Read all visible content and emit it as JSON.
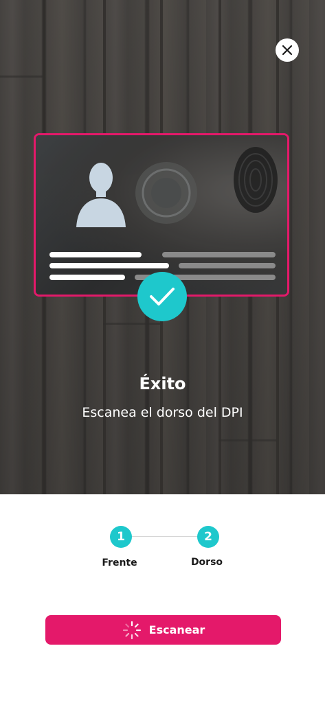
{
  "header": {
    "close_icon": "close-icon"
  },
  "card": {
    "accent_color": "#e4196a",
    "avatar_icon": "person-silhouette-icon",
    "seal_icon": "seal-icon",
    "fingerprint_icon": "fingerprint-icon"
  },
  "status": {
    "icon": "check-icon",
    "badge_color": "#1ec8cc",
    "title": "Éxito",
    "message": "Escanea el dorso del DPI"
  },
  "steps": [
    {
      "number": "1",
      "label": "Frente"
    },
    {
      "number": "2",
      "label": "Dorso"
    }
  ],
  "action": {
    "label": "Escanear",
    "icon": "spinner-icon",
    "color": "#e4196a"
  }
}
